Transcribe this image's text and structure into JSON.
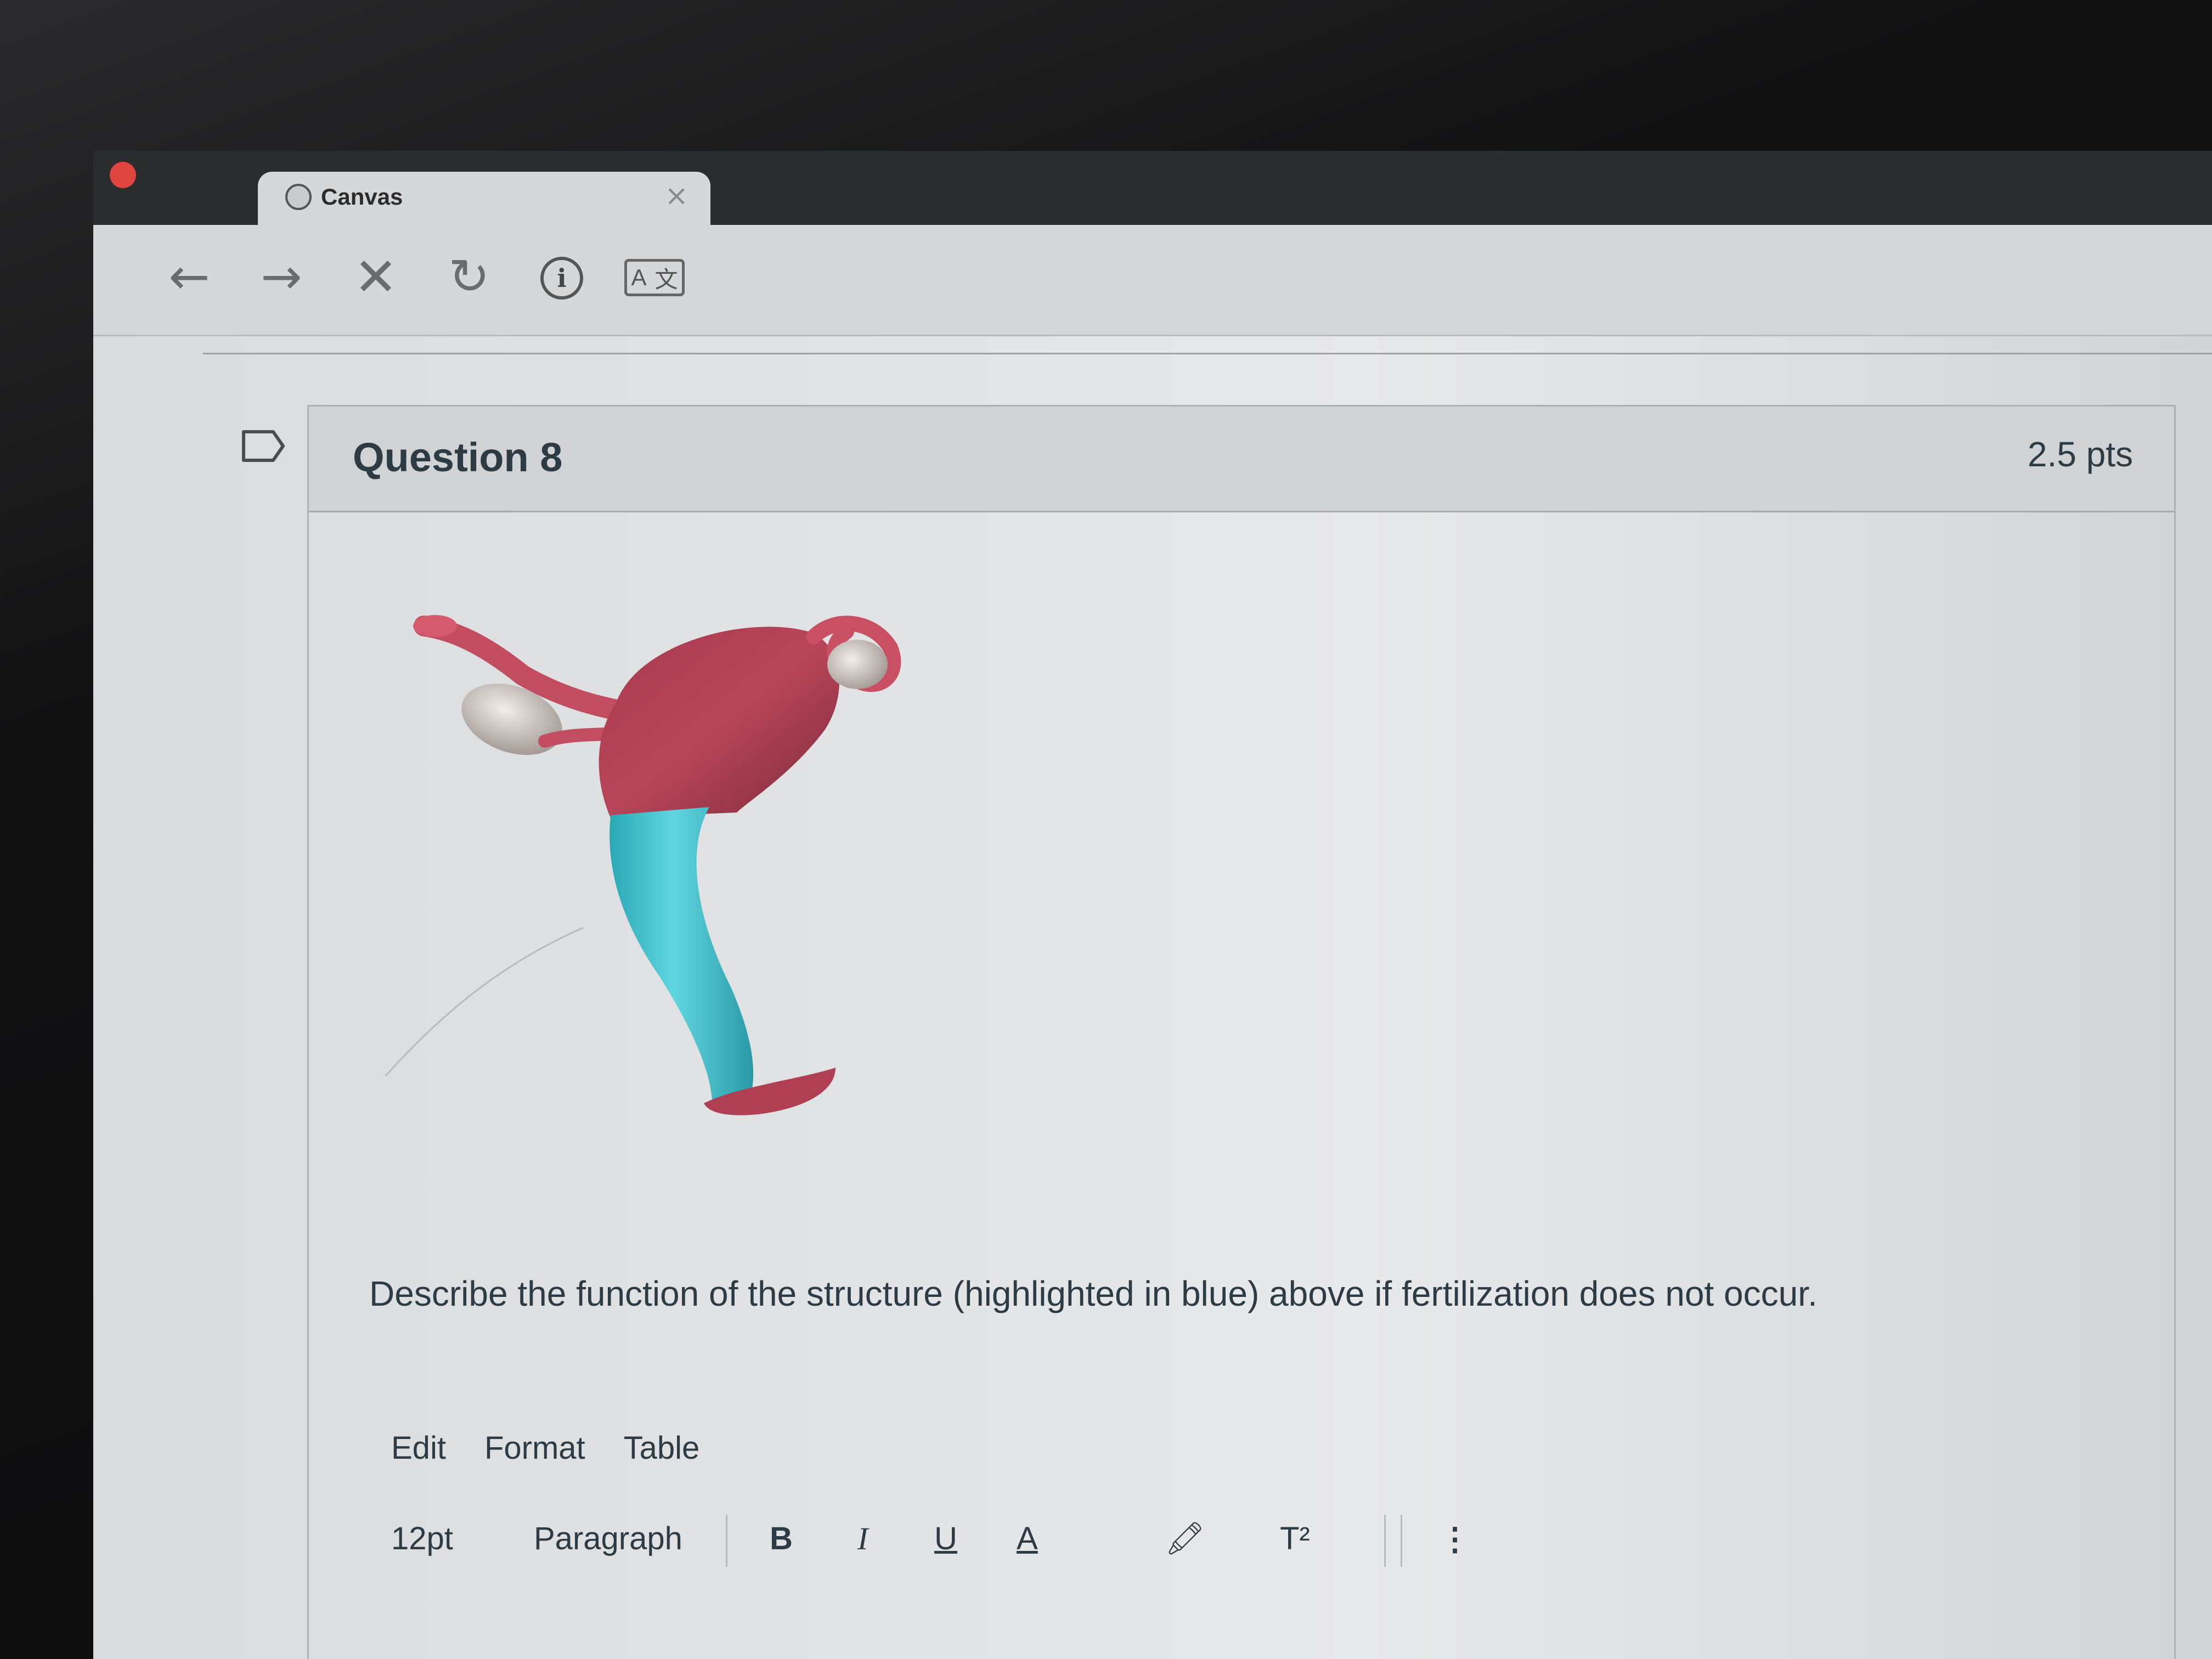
{
  "browser": {
    "tab_title": "Canvas",
    "tab_close": "×",
    "toolbar": {
      "back": "←",
      "forward": "→",
      "stop": "✕",
      "reload": "↻",
      "info": "i",
      "translate_a": "A",
      "translate_b": "文"
    }
  },
  "question": {
    "title": "Question 8",
    "points": "2.5 pts",
    "prompt": "Describe the function of the structure (highlighted in blue) above if fertilization does not occur."
  },
  "editor": {
    "menu": [
      "Edit",
      "Format",
      "Table"
    ],
    "toolbar": {
      "font_size": "12pt",
      "block_format": "Paragraph",
      "bold": "B",
      "italic": "I",
      "underline": "U",
      "text_color": "A",
      "highlight": "🖍",
      "superscript": "T²",
      "more": "⋮"
    }
  },
  "colors": {
    "uterus": "#b9455a",
    "highlight_structure": "#3ec3cf"
  }
}
